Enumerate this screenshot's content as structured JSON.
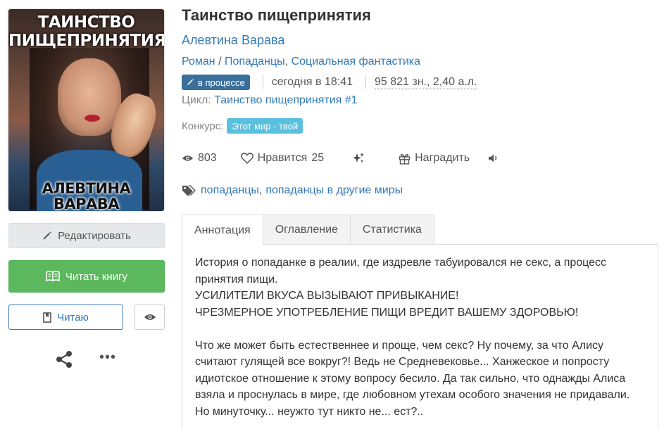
{
  "book": {
    "title": "Таинство пищепринятия",
    "author": "Алевтина Варава",
    "genres": [
      "Роман",
      "Попаданцы",
      "Социальная фантастика"
    ],
    "genre_separators": [
      "/",
      ","
    ],
    "status_label": "в процессе",
    "updated": "сегодня в 18:41",
    "size": "95 821 зн., 2,40 а.л.",
    "cycle_label": "Цикл:",
    "cycle_name": "Таинство пищепринятия #1",
    "contest_label": "Конкурс:",
    "contest_name": "Этот мир - твой"
  },
  "cover": {
    "title_line1": "ТАИНСТВО",
    "title_line2": "ПИЩЕПРИНЯТИЯ",
    "author_line1": "АЛЕВТИНА",
    "author_line2": "ВАРАВА"
  },
  "stats": {
    "views": "803",
    "likes_label": "Нравится",
    "likes": "25",
    "reward_label": "Наградить"
  },
  "tags": [
    "попаданцы",
    "попаданцы в другие миры"
  ],
  "tags_separator": ",",
  "buttons": {
    "edit": "Редактировать",
    "read": "Читать книгу",
    "reading": "Читаю"
  },
  "tabs": [
    "Аннотация",
    "Оглавление",
    "Статистика"
  ],
  "annotation": {
    "p1": "История о попаданке в реалии, где издревле табуировался не секс, а процесс принятия пищи.",
    "p2": "УСИЛИТЕЛИ ВКУСА ВЫЗЫВАЮТ ПРИВЫКАНИЕ!",
    "p3": "ЧРЕЗМЕРНОЕ УПОТРЕБЛЕНИЕ ПИЩИ ВРЕДИТ ВАШЕМУ ЗДОРОВЬЮ!",
    "p4": "Что же может быть естественнее и проще, чем секс? Ну почему, за что Алису считают гулящей все вокруг?! Ведь не Средневековье... Ханжеское и попросту идиотское отношение к этому вопросу бесило. Да так сильно, что однажды Алиса взяла и проснулась в мире, где любовном утехам особого значения не придавали. Но минуточку... неужто тут никто не... ест?.."
  },
  "more_label": "•••",
  "colors": {
    "link": "#337ab7",
    "success": "#5cb85c",
    "status_badge": "#3a6f9c",
    "contest_badge": "#5bc0de"
  },
  "icons": [
    "pencil-icon",
    "book-open-icon",
    "bookmark-icon",
    "eye-icon",
    "share-icon",
    "more-icon",
    "views-eye-icon",
    "heart-icon",
    "sparkle-icon",
    "gift-icon",
    "volume-icon",
    "tag-icon"
  ]
}
